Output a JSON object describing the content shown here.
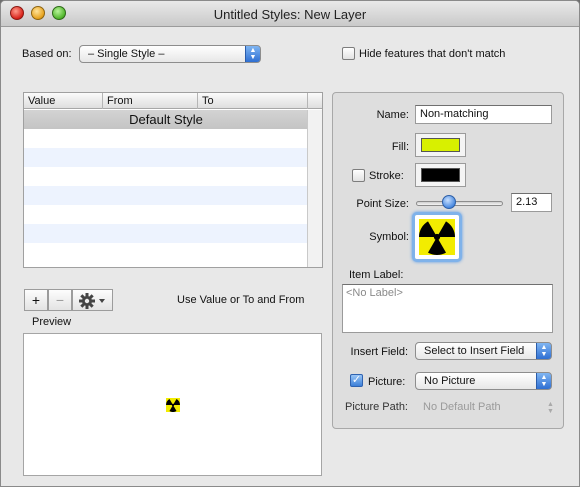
{
  "window": {
    "title": "Untitled Styles: New Layer"
  },
  "top_controls": {
    "based_on_label": "Based on:",
    "based_on_value": "– Single Style –",
    "hide_features_label": "Hide features that don't match",
    "hide_features_checked": false
  },
  "table": {
    "columns": [
      "Value",
      "From",
      "To"
    ],
    "rows": [
      {
        "label": "Default Style",
        "selected": true
      }
    ]
  },
  "table_toolbar": {
    "add_label": "+",
    "remove_label": "−",
    "gear_icon": "gear-icon",
    "hint": "Use Value or To and From"
  },
  "preview": {
    "label": "Preview",
    "symbol_icon": "radiation-icon"
  },
  "style_panel": {
    "name_label": "Name:",
    "name_value": "Non-matching",
    "fill_label": "Fill:",
    "fill_color": "#d8f000",
    "stroke_label": "Stroke:",
    "stroke_checked": false,
    "stroke_color": "#000000",
    "point_size_label": "Point Size:",
    "point_size_value": "2.13",
    "point_size_level": 0.35,
    "symbol_label": "Symbol:",
    "symbol_icon": "radiation-icon",
    "symbol_color": "#f2ec00",
    "item_label_label": "Item Label:",
    "item_label_placeholder": "<No Label>",
    "insert_field_label": "Insert Field:",
    "insert_field_value": "Select to Insert Field",
    "picture_label": "Picture:",
    "picture_checked": true,
    "picture_value": "No Picture",
    "picture_path_label": "Picture Path:",
    "picture_path_value": "No Default Path"
  }
}
